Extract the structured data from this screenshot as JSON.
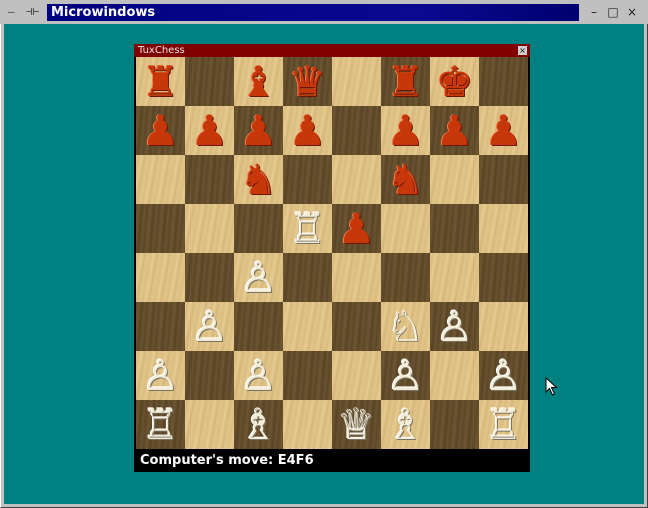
{
  "window": {
    "title": "Microwindows",
    "sys_icons": {
      "minimize": "—",
      "pin": "⊣⊢"
    },
    "buttons": {
      "minimize": "–",
      "maximize": "□",
      "close": "×"
    }
  },
  "tuxchess": {
    "title": "TuxChess",
    "close_symbol": "×",
    "status": "Computer's move: E4F6"
  },
  "board": {
    "rows": [
      [
        "♜",
        "",
        "♝",
        "♛",
        "",
        "♜",
        "♚",
        ""
      ],
      [
        "♟",
        "♟",
        "♟",
        "♟",
        "",
        "♟",
        "♟",
        "♟"
      ],
      [
        "",
        "",
        "♞",
        "",
        "",
        "♞",
        "",
        ""
      ],
      [
        "",
        "",
        "",
        "♖",
        "♟",
        "",
        "",
        ""
      ],
      [
        "",
        "",
        "♙",
        "",
        "",
        "",
        "",
        ""
      ],
      [
        "",
        "♙",
        "",
        "",
        "",
        "♘",
        "♙",
        ""
      ],
      [
        "♙",
        "",
        "♙",
        "",
        "",
        "♙",
        "",
        "♙"
      ],
      [
        "♖",
        "",
        "♗",
        "",
        "♕",
        "♗",
        "",
        "♖"
      ]
    ],
    "colors": [
      [
        "r",
        "",
        "r",
        "r",
        "",
        "r",
        "r",
        ""
      ],
      [
        "r",
        "r",
        "r",
        "r",
        "",
        "r",
        "r",
        "r"
      ],
      [
        "",
        "",
        "r",
        "",
        "",
        "r",
        "",
        ""
      ],
      [
        "",
        "",
        "",
        "w",
        "r",
        "",
        "",
        ""
      ],
      [
        "",
        "",
        "w",
        "",
        "",
        "",
        "",
        ""
      ],
      [
        "",
        "w",
        "",
        "",
        "",
        "w",
        "w",
        ""
      ],
      [
        "w",
        "",
        "w",
        "",
        "",
        "w",
        "",
        "w"
      ],
      [
        "w",
        "",
        "w",
        "",
        "w",
        "w",
        "",
        "w"
      ]
    ]
  },
  "colors": {
    "desktop": "#008080",
    "titlebar": "#000080",
    "tuxchess_title": "#800000",
    "red_piece": "#c8370a",
    "white_piece": "#f2ecd6"
  }
}
